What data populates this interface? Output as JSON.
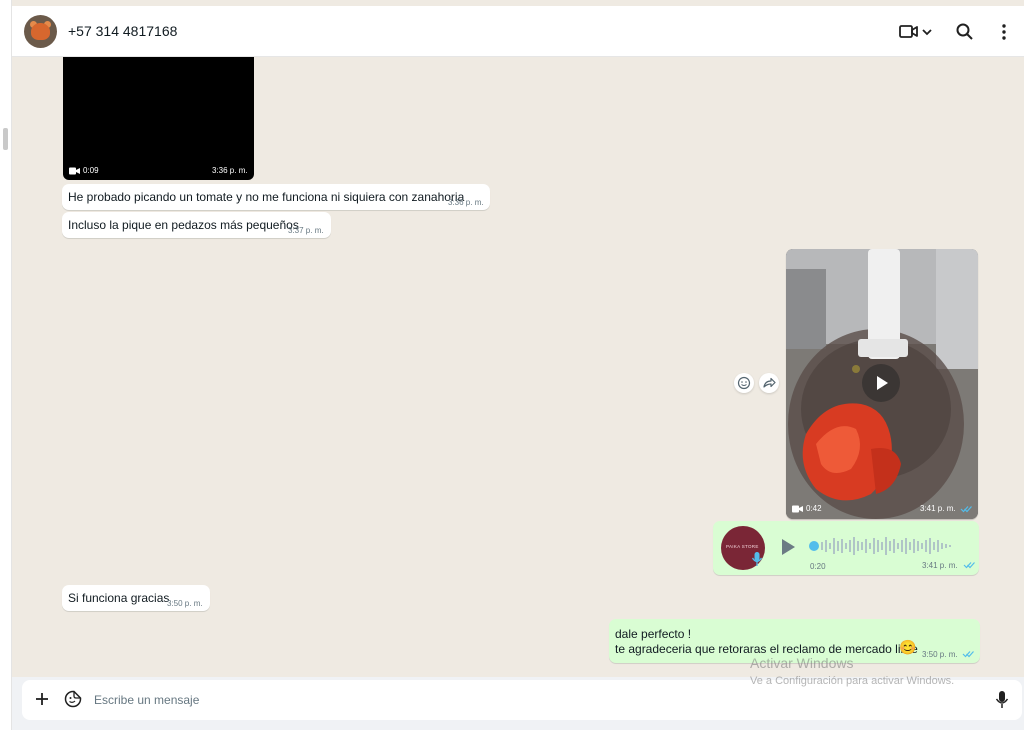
{
  "header": {
    "contact_name": "+57 314 4817168",
    "icons": [
      "video-call-icon",
      "chevron-down-icon",
      "search-icon",
      "menu-icon"
    ]
  },
  "messages": {
    "video1": {
      "duration": "0:09",
      "time": "3:36 p. m."
    },
    "m1": {
      "text": "He probado picando un tomate y no me funciona ni siquiera con zanahoria",
      "time": "3:36 p. m."
    },
    "m2": {
      "text": "Incluso la pique en pedazos más pequeños",
      "time": "3:37 p. m."
    },
    "video2": {
      "duration": "0:42",
      "time": "3:41 p. m."
    },
    "audio": {
      "avatar_text": "PAIKA STORE",
      "duration": "0:20",
      "time": "3:41 p. m."
    },
    "m3": {
      "text": "Si funciona gracias",
      "time": "3:50 p. m."
    },
    "m4": {
      "line1": "dale perfecto !",
      "line2": "te agradeceria que retoraras el reclamo de mercado libre",
      "emoji": "😊",
      "time": "3:50 p. m."
    }
  },
  "composer": {
    "placeholder": "Escribe un mensaje"
  },
  "watermark": {
    "line1": "Activar Windows",
    "line2": "Ve a Configuración para activar Windows."
  },
  "colors": {
    "outgoing_bubble": "#d9fdd3",
    "incoming_bubble": "#ffffff",
    "background": "#efeae2",
    "read_tick": "#53bdeb"
  }
}
